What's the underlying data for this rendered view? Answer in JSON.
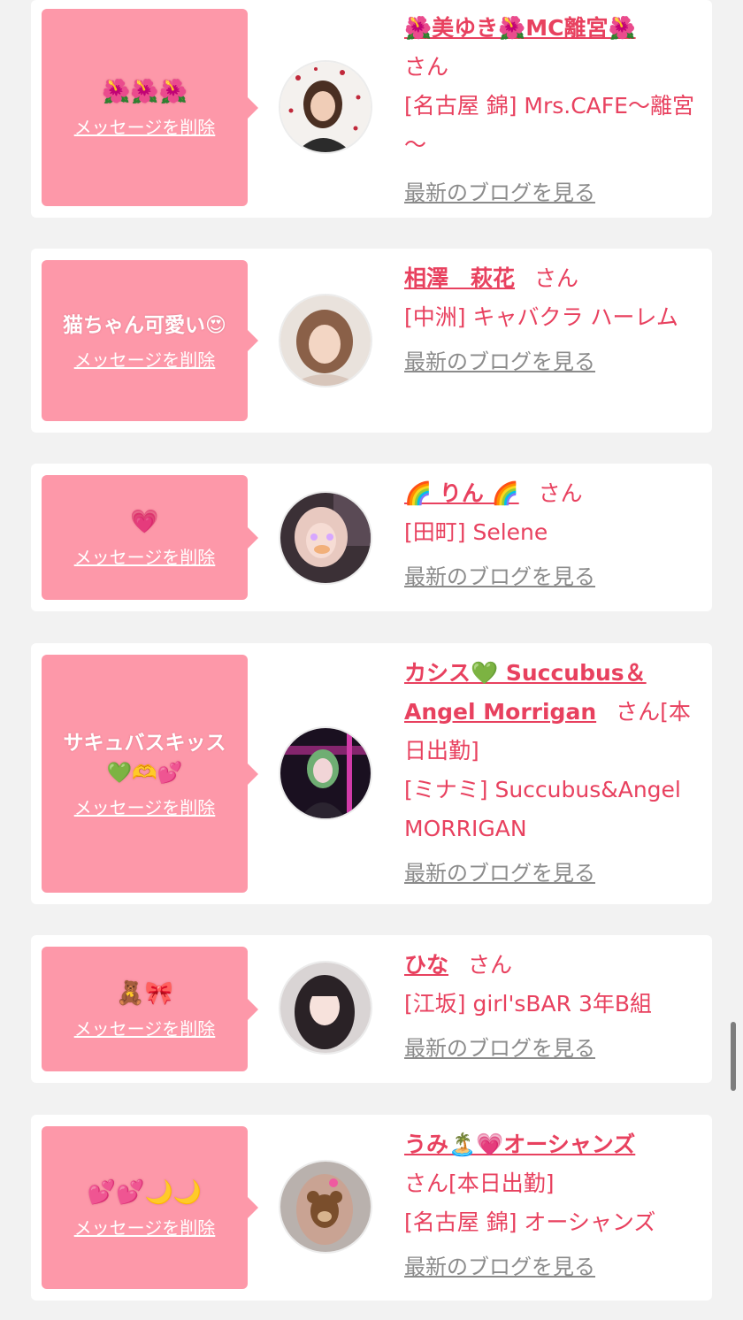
{
  "delete_label": "メッセージを削除",
  "blog_label": "最新のブログを見る",
  "san_label": "さん",
  "colors": {
    "background": "#f2f2f2",
    "bubble": "#fd98a9",
    "accent": "#e8415f",
    "blog_link": "#8b8b8b"
  },
  "entries": [
    {
      "message": "🌺🌺🌺",
      "name": "🌺美ゆき🌺MC離宮🌺",
      "san_suffix": "",
      "shop": "[名古屋 錦] Mrs.CAFE～離宮～"
    },
    {
      "message": "猫ちゃん可愛い😍",
      "name": "相澤　萩花",
      "san_suffix": "",
      "shop": "[中洲] キャバクラ ハーレム"
    },
    {
      "message": "💗",
      "name": "🌈 りん 🌈",
      "san_suffix": "",
      "shop": "[田町] Selene"
    },
    {
      "message": "サキュバスキッス💚🫶💕",
      "name": "カシス💚 Succubus＆Angel Morrigan",
      "san_suffix": "[本日出勤]",
      "shop": "[ミナミ] Succubus&Angel MORRIGAN"
    },
    {
      "message": "🧸🎀",
      "name": "ひな",
      "san_suffix": "",
      "shop": "[江坂] girl'sBAR 3年B組"
    },
    {
      "message": "💕💕🌙🌙",
      "name": "うみ🏝️💗オーシャンズ",
      "san_suffix": "[本日出勤]",
      "shop": "[名古屋 錦] オーシャンズ"
    }
  ]
}
